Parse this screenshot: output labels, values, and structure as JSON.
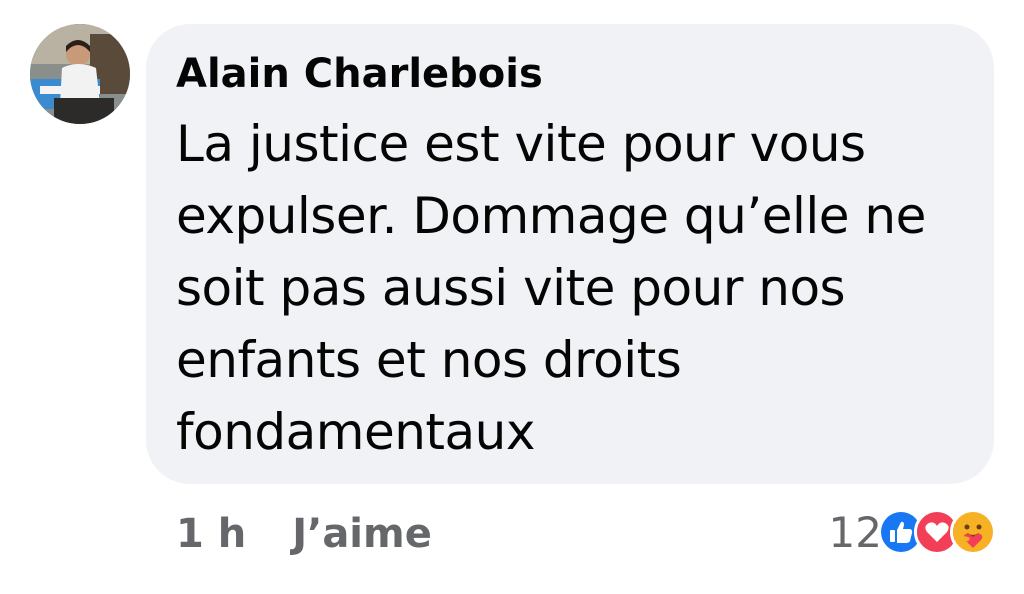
{
  "comment": {
    "author": "Alain Charlebois",
    "text_lines": [
      "La justice est vite pour vous",
      "expulser. Dommage qu’elle ne",
      "soit pas aussi vite pour nos",
      "enfants et nos droits",
      "fondamentaux"
    ],
    "time": "1 h",
    "like_label": "J’aime",
    "reaction_count": "12",
    "reactions": [
      "like-icon",
      "love-icon",
      "care-icon"
    ]
  },
  "colors": {
    "bubble": "#f0f2f5",
    "text": "#050505",
    "meta": "#65676b",
    "like": "#1877f2",
    "love": "#f33e58",
    "care": "#f7b125"
  }
}
